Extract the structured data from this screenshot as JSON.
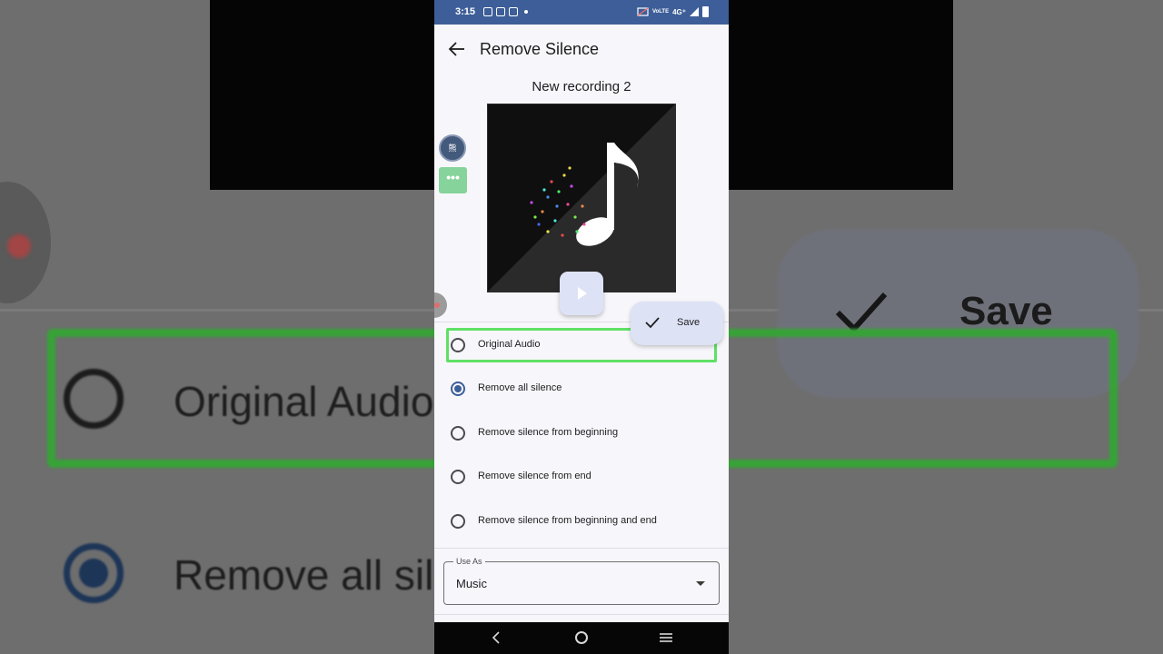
{
  "status_bar": {
    "time": "3:15",
    "network": "4G⁺",
    "volte": "VoLTE"
  },
  "app_bar": {
    "title": "Remove Silence",
    "back_icon": "arrow-left-icon"
  },
  "recording": {
    "name": "New recording 2",
    "artwork_icon": "music-note-icon"
  },
  "floating": {
    "avatar_text": "熊",
    "more_text": "•••",
    "play_icon": "play-icon"
  },
  "save_button": {
    "label": "Save",
    "icon": "check-icon"
  },
  "options": [
    {
      "label": "Original Audio",
      "selected": false
    },
    {
      "label": "Remove all silence",
      "selected": true
    },
    {
      "label": "Remove silence from beginning",
      "selected": false
    },
    {
      "label": "Remove silence from end",
      "selected": false
    },
    {
      "label": "Remove silence from beginning and end",
      "selected": false
    }
  ],
  "use_as": {
    "label": "Use As",
    "value": "Music",
    "icon": "dropdown-arrow-icon"
  },
  "background_zoom": {
    "save_label": "Save",
    "option_1": "Original Audio",
    "option_2": "Remove all sile"
  },
  "colors": {
    "status_bar": "#3d5e98",
    "highlight": "#5fe065",
    "accent": "#3d5e98",
    "fab": "#dde2f5"
  }
}
